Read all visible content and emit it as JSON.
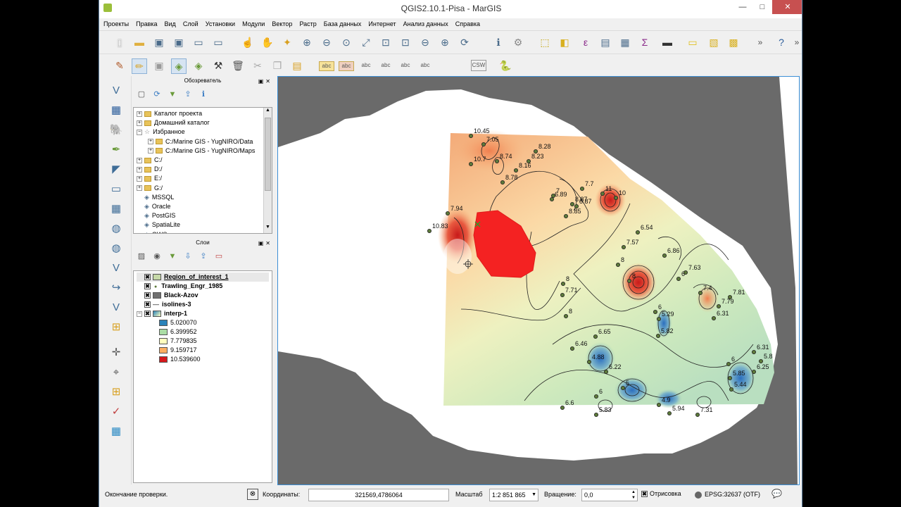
{
  "window": {
    "title": "QGIS2.10.1-Pisa - MarGIS",
    "minimize": "—",
    "maximize": "□",
    "close": "✕"
  },
  "menu": [
    "Проекты",
    "Правка",
    "Вид",
    "Слой",
    "Установки",
    "Модули",
    "Вектор",
    "Растр",
    "База данных",
    "Интернет",
    "Анализ данных",
    "Справка"
  ],
  "toolbar2": {
    "label_button": "abc",
    "csw_button": "CSW"
  },
  "browser": {
    "title": "Обозреватель",
    "items": [
      {
        "label": "Каталог проекта",
        "level": 0,
        "expand": "+",
        "icon": "folder"
      },
      {
        "label": "Домашний каталог",
        "level": 0,
        "expand": "+",
        "icon": "folder"
      },
      {
        "label": "Избранное",
        "level": 0,
        "expand": "-",
        "icon": "star"
      },
      {
        "label": "C:/Marine GIS - YugNIRO/Data",
        "level": 1,
        "expand": "+",
        "icon": "folder"
      },
      {
        "label": "C:/Marine GIS - YugNIRO/Maps",
        "level": 1,
        "expand": "+",
        "icon": "folder"
      },
      {
        "label": "C:/",
        "level": 0,
        "expand": "+",
        "icon": "folder"
      },
      {
        "label": "D:/",
        "level": 0,
        "expand": "+",
        "icon": "folder"
      },
      {
        "label": "E:/",
        "level": 0,
        "expand": "+",
        "icon": "folder"
      },
      {
        "label": "G:/",
        "level": 0,
        "expand": "+",
        "icon": "folder"
      },
      {
        "label": "MSSQL",
        "level": 0,
        "expand": "",
        "icon": "db"
      },
      {
        "label": "Oracle",
        "level": 0,
        "expand": "",
        "icon": "db"
      },
      {
        "label": "PostGIS",
        "level": 0,
        "expand": "",
        "icon": "db"
      },
      {
        "label": "SpatiaLite",
        "level": 0,
        "expand": "",
        "icon": "db"
      },
      {
        "label": "OWS",
        "level": 0,
        "expand": "",
        "icon": "db"
      }
    ]
  },
  "layers": {
    "title": "Слои",
    "items": [
      {
        "label": "Region_of_interest_1",
        "checked": "✖",
        "symbol": "poly",
        "selected": true
      },
      {
        "label": "Trawling_Engr_1985",
        "checked": "✖",
        "symbol": "point"
      },
      {
        "label": "Black-Azov",
        "checked": "✖",
        "symbol": "grey"
      },
      {
        "label": "isolines-3",
        "checked": "✖",
        "symbol": "line"
      },
      {
        "label": "interp-1",
        "checked": "✖",
        "symbol": "raster"
      }
    ],
    "legend": [
      {
        "value": "5.020070",
        "color": "#2b83ba"
      },
      {
        "value": "6.399952",
        "color": "#abdda4"
      },
      {
        "value": "7.779835",
        "color": "#ffffbf"
      },
      {
        "value": "9.159717",
        "color": "#fdae61"
      },
      {
        "value": "10.539600",
        "color": "#d7191c"
      }
    ]
  },
  "map": {
    "labels": [
      "10.45",
      "7.05",
      "8.74",
      "10.7",
      "8.28",
      "8.23",
      "8.16",
      "8.78",
      "7",
      "8.87",
      "7.7",
      "11",
      "10",
      "6.89",
      "8.87",
      "8.85",
      "7.94",
      "10.83",
      "8",
      "6.54",
      "7.57",
      "6.86",
      "6",
      "7.63",
      "8",
      "8",
      "7.4",
      "7.81",
      "7.79",
      "6.31",
      "7.71",
      "8",
      "6",
      "5.29",
      "5.82",
      "6.65",
      "6.46",
      "4.88",
      "6.22",
      "5",
      "6.31",
      "5.8",
      "6.25",
      "6",
      "5.85",
      "5.44",
      "6",
      "6.6",
      "5.83",
      "4.9",
      "5.94",
      "7.31"
    ]
  },
  "status": {
    "message": "Окончание проверки.",
    "coord_label": "Координаты:",
    "coord_value": "321569,4786064",
    "scale_label": "Масштаб",
    "scale_value": "1:2 851 865",
    "rotation_label": "Вращение:",
    "rotation_value": "0,0",
    "render_label": "Отрисовка",
    "crs": "EPSG:32637 (OTF)"
  }
}
